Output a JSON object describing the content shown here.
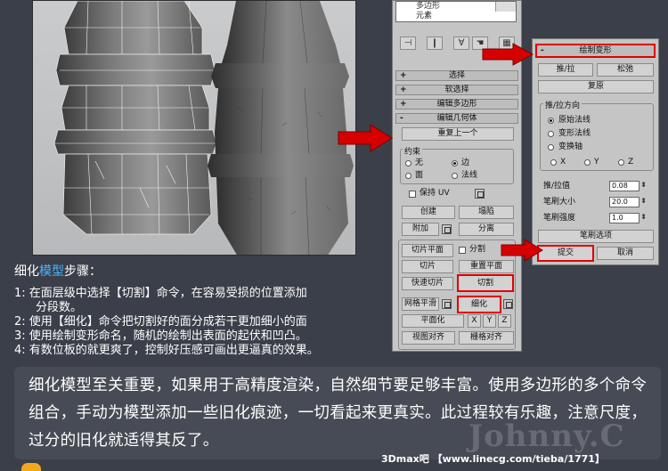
{
  "panel": {
    "stack_items": [
      "多边形",
      "元素"
    ],
    "rollouts": [
      {
        "sign": "+",
        "label": "选择"
      },
      {
        "sign": "+",
        "label": "软选择"
      },
      {
        "sign": "+",
        "label": "编辑多边形"
      },
      {
        "sign": "-",
        "label": "编辑几何体"
      }
    ],
    "repeat_last": "重复上一个",
    "constraints_label": "约束",
    "constraints": [
      "无",
      "边",
      "面",
      "法线"
    ],
    "preserve_uv": "保持 UV",
    "create": "创建",
    "collapse": "塌陷",
    "attach": "附加",
    "detach": "分离",
    "slice_plane": "切片平面",
    "split": "分割",
    "slice": "切片",
    "reset_plane": "重置平面",
    "quickslice": "快速切片",
    "cut": "切割",
    "msmooth": "网格平滑",
    "tessellate": "细化",
    "planar": "平面化",
    "x": "X",
    "y": "Y",
    "z": "Z",
    "view_align": "视图对齐",
    "grid_align": "栅格对齐"
  },
  "paint": {
    "title": "绘制变形",
    "sign": "-",
    "push_pull": "推/拉",
    "relax": "松弛",
    "revert": "复原",
    "direction_label": "推/拉方向",
    "dir_original": "原始法线",
    "dir_deformed": "变形法线",
    "transform_axis": "变换轴",
    "axis_x": "X",
    "axis_y": "Y",
    "axis_z": "Z",
    "push_value_label": "推/拉值",
    "push_value": "0.08",
    "brush_size_label": "笔刷大小",
    "brush_size": "20.0",
    "brush_strength_label": "笔刷强度",
    "brush_strength": "1.0",
    "brush_options": "笔刷选项",
    "commit": "提交",
    "cancel": "取消"
  },
  "steps": {
    "head_pre": "细化",
    "head_hl": "模型",
    "head_post": "步骤：",
    "s1a": "1: 在面层级中选择【切割】命令，在容易受损的位置添加",
    "s1b": "分段数。",
    "s2": "2: 使用【细化】命令把切割好的面分成若干更加细小的面",
    "s3": "3: 使用绘制变形命名，随机的绘制出表面的起伏和凹凸。",
    "s4": "4: 有数位板的就更爽了，控制好压感可画出更逼真的效果。"
  },
  "summary": "细化模型至关重要，如果用于高精度渲染，自然细节要足够丰富。使用多边形的多个命令组合，手动为模型添加一些旧化痕迹，一切看起来更真实。此过程较有乐趣，注意尺度，过分的旧化就适得其反了。",
  "watermark": "Johnny.C",
  "credit_site": "3Dmax吧",
  "credit_url": "【www.linecg.com/tieba/1771】",
  "colors": {
    "highlight_red": "#e30000",
    "heading_accent": "#4fb3ff",
    "arrow_red": "#d60000"
  }
}
